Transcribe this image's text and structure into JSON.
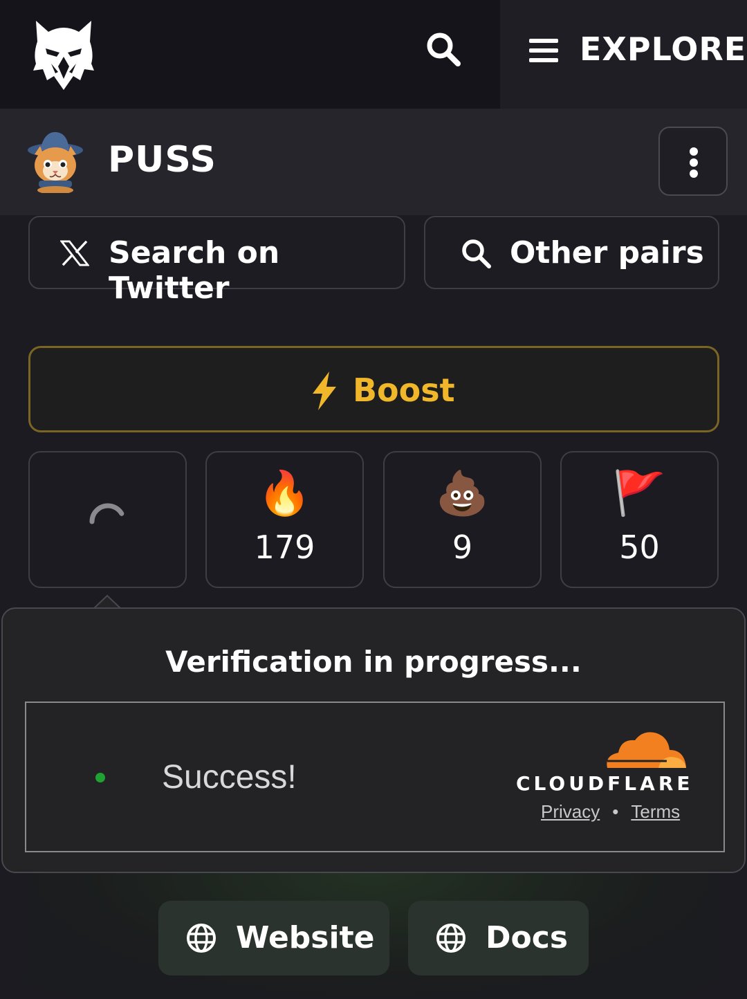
{
  "topbar": {
    "logo_icon": "eagle-logo",
    "search_icon": "search-icon",
    "menu_icon": "hamburger-icon",
    "explore_label": "EXPLORE"
  },
  "token": {
    "name": "PUSS",
    "avatar_icon": "cat-wizard-avatar",
    "more_icon": "vertical-dots-icon"
  },
  "actions": {
    "twitter_label": "Search on Twitter",
    "twitter_icon": "x-logo-icon",
    "pairs_label": "Other pairs",
    "pairs_icon": "search-icon"
  },
  "boost": {
    "label": "Boost",
    "icon": "lightning-icon",
    "color": "#f0b72a"
  },
  "stats": [
    {
      "icon": "loading-spinner",
      "emoji": "",
      "value": ""
    },
    {
      "icon": "fire-emoji",
      "emoji": "🔥",
      "value": "179"
    },
    {
      "icon": "poop-emoji",
      "emoji": "💩",
      "value": "9"
    },
    {
      "icon": "red-flag-emoji",
      "emoji": "🚩",
      "value": "50"
    }
  ],
  "verification": {
    "title": "Verification in progress...",
    "status": "Success!",
    "status_color": "#1fa233",
    "provider": "CLOUDFLARE",
    "privacy_label": "Privacy",
    "separator": "•",
    "terms_label": "Terms"
  },
  "links": {
    "website_label": "Website",
    "docs_label": "Docs",
    "icon": "globe-icon"
  }
}
